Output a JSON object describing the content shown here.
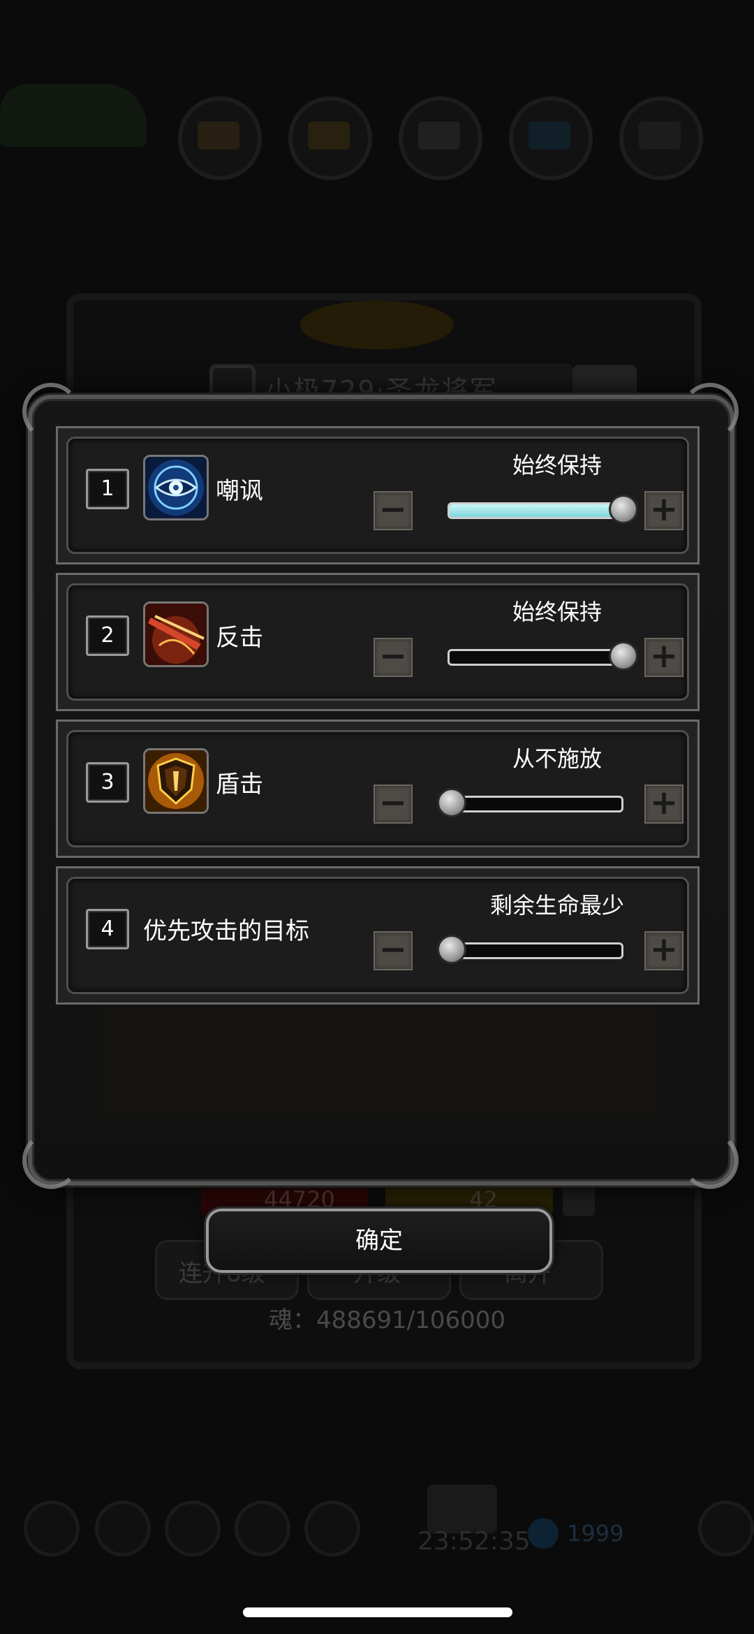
{
  "background": {
    "title": "小极729·圣龙将军",
    "hp_value": "44720",
    "energy_value": "42",
    "buttons": [
      "连升8级",
      "升级",
      "离开"
    ],
    "soul": "魂：488691/106000",
    "clock": "23:52:35",
    "gems": "1999"
  },
  "rows": [
    {
      "index": "1",
      "name": "嘲讽",
      "icon": "eye-icon",
      "mode": "始终保持",
      "level": 1.0,
      "filled": true
    },
    {
      "index": "2",
      "name": "反击",
      "icon": "slash-icon",
      "mode": "始终保持",
      "level": 1.0,
      "filled": false
    },
    {
      "index": "3",
      "name": "盾击",
      "icon": "shield-icon",
      "mode": "从不施放",
      "level": 0.0,
      "filled": false
    },
    {
      "index": "4",
      "name": "优先攻击的目标",
      "icon": "",
      "mode": "剩余生命最少",
      "level": 0.0,
      "filled": false
    }
  ],
  "controls": {
    "minus": "−",
    "plus": "+"
  },
  "confirm_label": "确定",
  "colors": {
    "slider_fill": "#7fd6dc",
    "panel_border": "#555555"
  }
}
